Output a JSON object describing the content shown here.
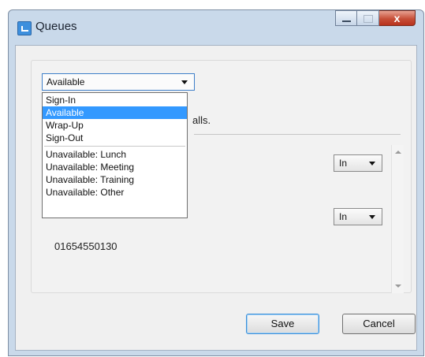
{
  "window": {
    "title": "Queues",
    "close_glyph": "x"
  },
  "status": {
    "selected": "Available",
    "options": [
      "Sign-In",
      "Available",
      "Wrap-Up",
      "Sign-Out",
      "Unavailable: Lunch",
      "Unavailable: Meeting",
      "Unavailable: Training",
      "Unavailable: Other"
    ],
    "highlighted_index": 1
  },
  "partial_text": "alls.",
  "queues": [
    {
      "direction": "In"
    },
    {
      "direction": "In"
    }
  ],
  "phone_number": "01654550130",
  "buttons": {
    "save": "Save",
    "cancel": "Cancel"
  },
  "colors": {
    "selection": "#3399ff",
    "close_button": "#c74f38"
  }
}
